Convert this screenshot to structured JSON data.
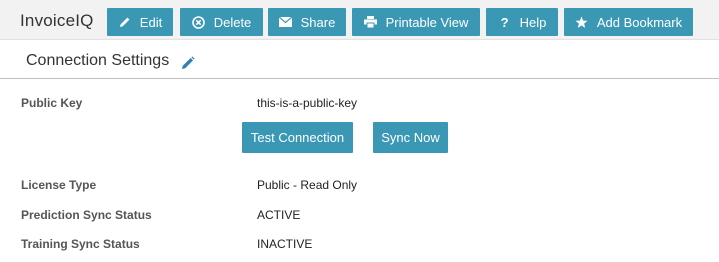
{
  "toolbar": {
    "app_title": "InvoiceIQ",
    "buttons": [
      {
        "label": "Edit",
        "icon": "pencil-icon"
      },
      {
        "label": "Delete",
        "icon": "times-circle-icon"
      },
      {
        "label": "Share",
        "icon": "envelope-icon"
      },
      {
        "label": "Printable View",
        "icon": "print-icon"
      },
      {
        "label": "Help",
        "icon": "question-icon"
      },
      {
        "label": "Add Bookmark",
        "icon": "star-icon"
      }
    ]
  },
  "section": {
    "title": "Connection Settings",
    "edit_icon": "pencil-icon"
  },
  "fields": {
    "public_key": {
      "label": "Public Key",
      "value": "this-is-a-public-key"
    },
    "license_type": {
      "label": "License Type",
      "value": "Public - Read Only"
    },
    "prediction_sync": {
      "label": "Prediction Sync Status",
      "value": "ACTIVE"
    },
    "training_sync": {
      "label": "Training Sync Status",
      "value": "INACTIVE"
    }
  },
  "actions": {
    "test_connection": "Test Connection",
    "sync_now": "Sync Now"
  },
  "colors": {
    "button_bg": "#3a98b5",
    "toolbar_bg": "#f2f2f2",
    "top_strip": "#1f2b3e"
  }
}
